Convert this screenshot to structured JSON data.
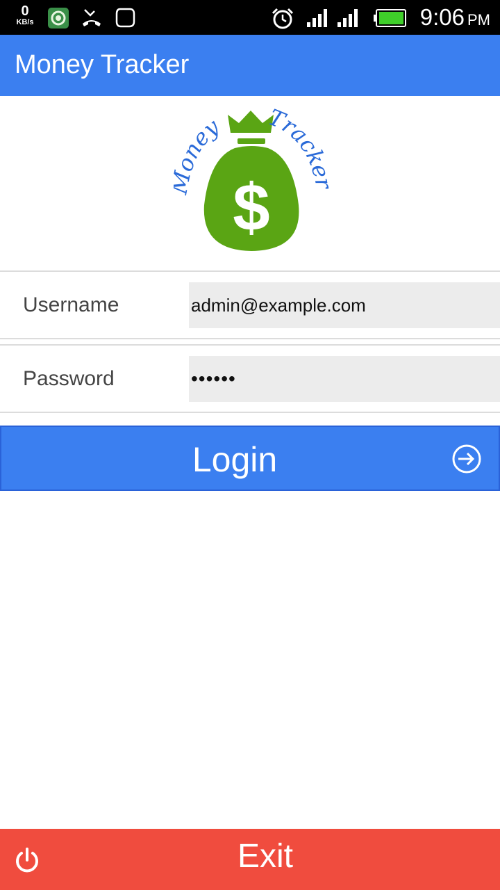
{
  "status_bar": {
    "net_speed_value": "0",
    "net_speed_unit": "KB/s",
    "time": "9:06",
    "ampm": "PM",
    "icons": [
      "app-notification-icon",
      "missed-call-icon",
      "chat-bubble-icon",
      "alarm-icon",
      "signal-icon",
      "signal-icon",
      "battery-icon"
    ]
  },
  "app_bar": {
    "title": "Money Tracker",
    "color": "#3b7ff0"
  },
  "logo": {
    "word_left": "Money",
    "word_right": "Tracker",
    "symbol": "$",
    "bag_color": "#5aa514",
    "text_color": "#2a6ad8"
  },
  "form": {
    "username_label": "Username",
    "username_value": "admin@example.com",
    "password_label": "Password",
    "password_value": "••••••"
  },
  "login_button": {
    "label": "Login",
    "icon": "login-arrow-icon"
  },
  "exit_button": {
    "label": "Exit",
    "icon": "power-icon",
    "color": "#f04c3e"
  }
}
